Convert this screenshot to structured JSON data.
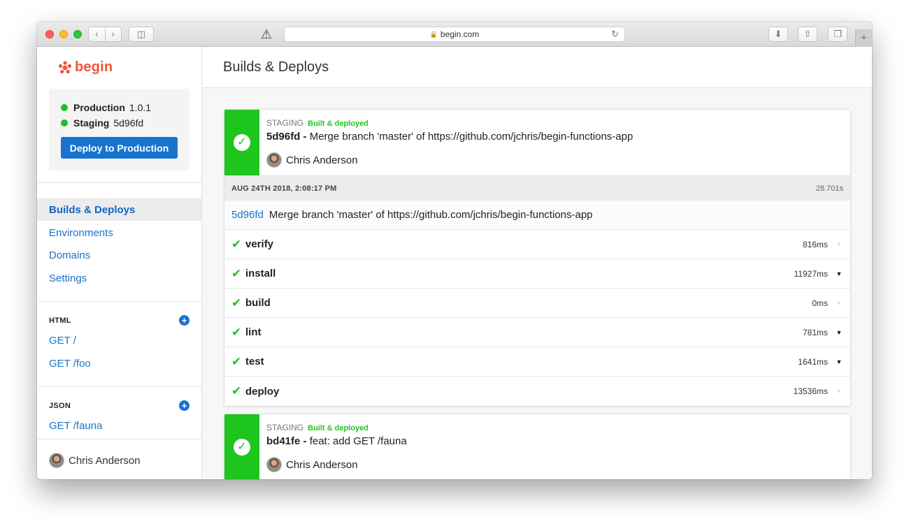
{
  "browser": {
    "url": "begin.com",
    "icons": {
      "back": "chevron-left-icon",
      "forward": "chevron-right-icon",
      "sidebar": "sidebar-icon",
      "warning": "warning-icon",
      "lock": "lock-icon",
      "reload": "reload-icon",
      "download": "download-icon",
      "share": "share-icon",
      "tabs": "tabs-icon",
      "new_tab": "plus-icon"
    }
  },
  "brand": {
    "name": "begin",
    "color": "#f1543a"
  },
  "environments": [
    {
      "name": "Production",
      "version": "1.0.1"
    },
    {
      "name": "Staging",
      "version": "5d96fd"
    }
  ],
  "deploy_button": "Deploy to Production",
  "nav": [
    {
      "label": "Builds & Deploys",
      "active": true
    },
    {
      "label": "Environments",
      "active": false
    },
    {
      "label": "Domains",
      "active": false
    },
    {
      "label": "Settings",
      "active": false
    }
  ],
  "sections": {
    "html": {
      "title": "HTML",
      "routes": [
        "GET /",
        "GET /foo"
      ]
    },
    "json": {
      "title": "JSON",
      "routes": [
        "GET /fauna"
      ]
    }
  },
  "user": {
    "name": "Chris Anderson"
  },
  "page_title": "Builds & Deploys",
  "colors": {
    "success": "#1ec51d",
    "link": "#1a73c7",
    "primary": "#1674cf"
  },
  "builds": [
    {
      "env": "STAGING",
      "status": "Built & deployed",
      "sha": "5d96fd",
      "message": "Merge branch 'master' of https://github.com/jchris/begin-functions-app",
      "author": "Chris Anderson",
      "date": "AUG 24TH 2018, 2:08:17 PM",
      "duration": "28.701s",
      "steps": [
        {
          "name": "verify",
          "time": "816ms",
          "expandable": false
        },
        {
          "name": "install",
          "time": "11927ms",
          "expandable": true
        },
        {
          "name": "build",
          "time": "0ms",
          "expandable": false
        },
        {
          "name": "lint",
          "time": "781ms",
          "expandable": true
        },
        {
          "name": "test",
          "time": "1641ms",
          "expandable": true
        },
        {
          "name": "deploy",
          "time": "13536ms",
          "expandable": false
        }
      ]
    },
    {
      "env": "STAGING",
      "status": "Built & deployed",
      "sha": "bd41fe",
      "message": "feat: add GET /fauna",
      "author": "Chris Anderson"
    }
  ]
}
